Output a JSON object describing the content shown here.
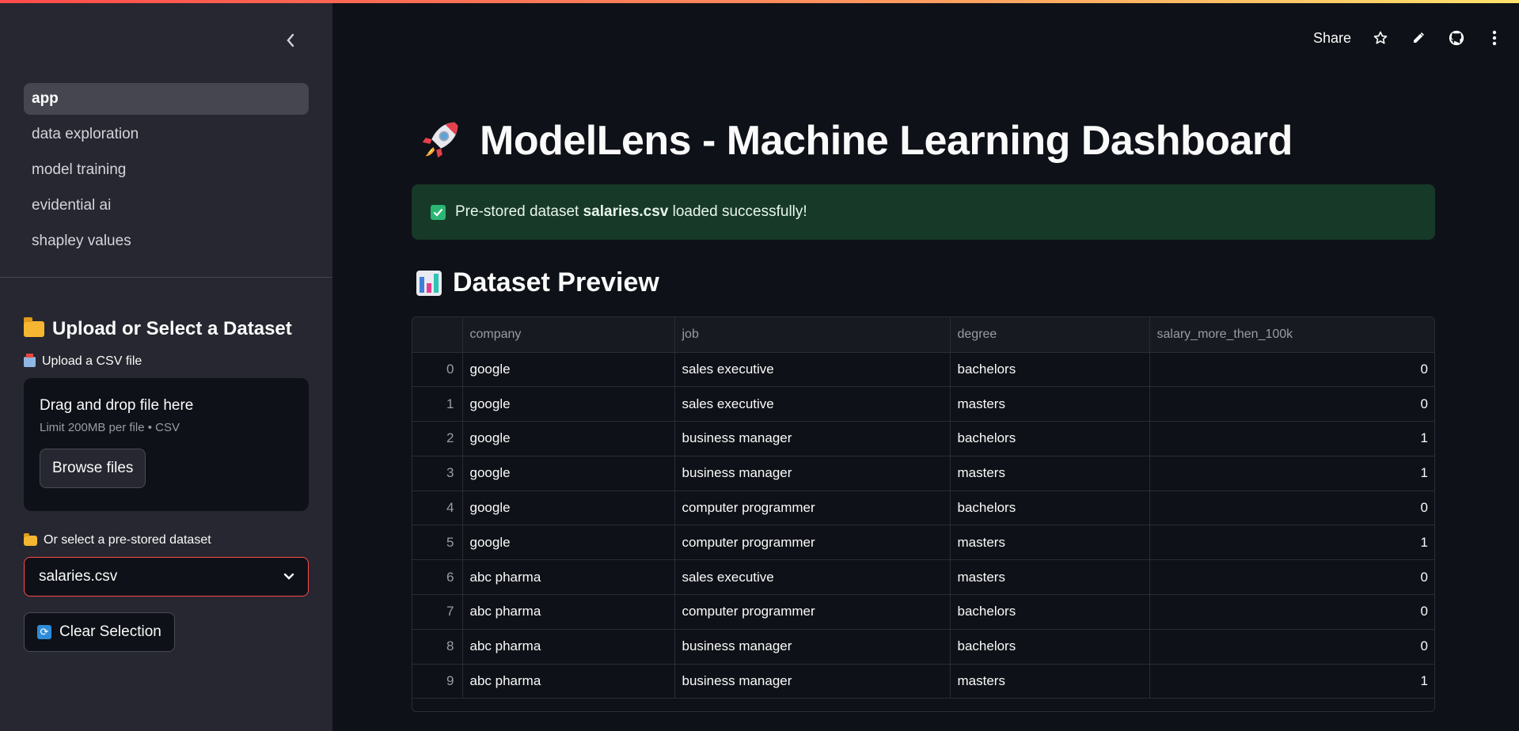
{
  "sidebar": {
    "nav": [
      {
        "label": "app",
        "active": true
      },
      {
        "label": "data exploration",
        "active": false
      },
      {
        "label": "model training",
        "active": false
      },
      {
        "label": "evidential ai",
        "active": false
      },
      {
        "label": "shapley values",
        "active": false
      }
    ],
    "upload_header": "Upload or Select a Dataset",
    "upload_label": "Upload a CSV file",
    "dropzone_title": "Drag and drop file here",
    "dropzone_sub": "Limit 200MB per file • CSV",
    "browse_label": "Browse files",
    "select_label": "Or select a pre-stored dataset",
    "select_value": "salaries.csv",
    "clear_label": "Clear Selection"
  },
  "toolbar": {
    "share_label": "Share"
  },
  "main": {
    "title": "ModelLens - Machine Learning Dashboard",
    "alert": {
      "prefix": "Pre-stored dataset ",
      "filename": "salaries.csv",
      "suffix": " loaded successfully!"
    },
    "section_title": "Dataset Preview",
    "table": {
      "columns": [
        "",
        "company",
        "job",
        "degree",
        "salary_more_then_100k"
      ],
      "rows": [
        [
          "0",
          "google",
          "sales executive",
          "bachelors",
          "0"
        ],
        [
          "1",
          "google",
          "sales executive",
          "masters",
          "0"
        ],
        [
          "2",
          "google",
          "business manager",
          "bachelors",
          "1"
        ],
        [
          "3",
          "google",
          "business manager",
          "masters",
          "1"
        ],
        [
          "4",
          "google",
          "computer programmer",
          "bachelors",
          "0"
        ],
        [
          "5",
          "google",
          "computer programmer",
          "masters",
          "1"
        ],
        [
          "6",
          "abc pharma",
          "sales executive",
          "masters",
          "0"
        ],
        [
          "7",
          "abc pharma",
          "computer programmer",
          "bachelors",
          "0"
        ],
        [
          "8",
          "abc pharma",
          "business manager",
          "bachelors",
          "0"
        ],
        [
          "9",
          "abc pharma",
          "business manager",
          "masters",
          "1"
        ]
      ]
    }
  },
  "colors": {
    "accent": "#ff4b4b",
    "success_bg": "#173928",
    "sidebar_bg": "#262730",
    "app_bg": "#0e1117"
  },
  "icons": [
    "chevron-left-icon",
    "star-icon",
    "pencil-icon",
    "github-icon",
    "more-vertical-icon",
    "rocket-icon",
    "check-icon",
    "bar-chart-icon",
    "folder-icon",
    "inbox-icon",
    "refresh-icon",
    "chevron-down-icon"
  ]
}
